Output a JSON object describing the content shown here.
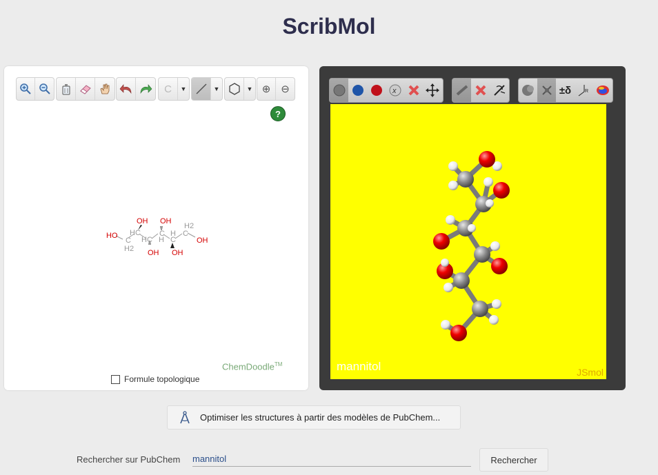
{
  "app": {
    "title": "ScribMol"
  },
  "editor": {
    "toolbar": {
      "zoom_in": "zoom-in-icon",
      "zoom_out": "zoom-out-icon",
      "clear": "clear-icon",
      "eraser": "eraser-icon",
      "pan": "hand-icon",
      "undo": "undo-icon",
      "redo": "redo-icon",
      "atom_label": "C",
      "bond": "single-bond-icon",
      "ring": "hexagon-ring-icon",
      "charge_plus": "⊕",
      "charge_minus": "⊖"
    },
    "help_label": "?",
    "structure": {
      "atoms_red": [
        "HO",
        "OH",
        "OH",
        "OH",
        "OH",
        "OH"
      ],
      "atoms_gray": [
        "H2",
        "HC",
        "HC",
        "C",
        "H",
        "C",
        "H",
        "C",
        "H2",
        "C"
      ]
    },
    "branding": "ChemDoodle",
    "branding_tm": "TM",
    "topo_checkbox_label": "Formule topologique",
    "topo_checked": false
  },
  "viewer": {
    "molecule_name": "mannitol",
    "engine_label": "JSmol",
    "background_color": "#ffff00",
    "toolbar_labels": {
      "charge": "±δ"
    }
  },
  "optimize": {
    "label": "Optimiser les structures à partir des modèles de PubChem..."
  },
  "search": {
    "label": "Rechercher sur PubChem",
    "value": "mannitol",
    "button": "Rechercher"
  }
}
